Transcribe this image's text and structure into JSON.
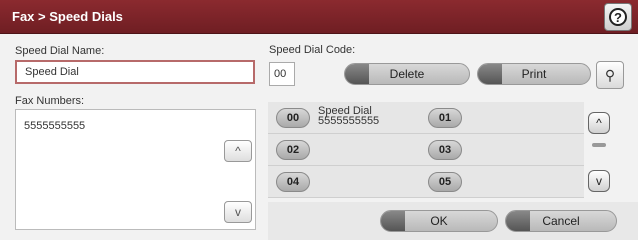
{
  "header": {
    "title": "Fax > Speed Dials"
  },
  "icons": {
    "help": "help-icon",
    "search": "search-icon"
  },
  "left": {
    "speed_dial_name_label": "Speed Dial Name:",
    "speed_dial_name_value": "Speed Dial",
    "fax_numbers_label": "Fax Numbers:",
    "fax_number_value": "5555555555"
  },
  "right": {
    "speed_dial_code_label": "Speed Dial Code:",
    "speed_dial_code_value": "00",
    "delete_label": "Delete",
    "print_label": "Print",
    "entries": [
      {
        "left_code": "00",
        "left_name": "Speed Dial",
        "left_number": "5555555555",
        "right_code": "01"
      },
      {
        "left_code": "02",
        "left_name": "",
        "left_number": "",
        "right_code": "03"
      },
      {
        "left_code": "04",
        "left_name": "",
        "left_number": "",
        "right_code": "05"
      }
    ],
    "ok_label": "OK",
    "cancel_label": "Cancel"
  }
}
